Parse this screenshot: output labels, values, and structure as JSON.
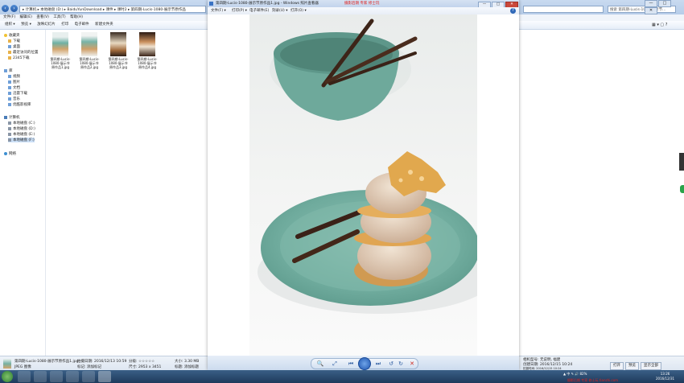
{
  "explorer": {
    "address": "▸ 计算机 ▸ 本地磁盘 (D:) ▸ BaiduYunDownload ▸ 课件 ▸ 课时2 ▸ 第四期-Lucis-1080-展示节原作品",
    "search_placeholder": "搜索 第四期-Lucis-1080-展示节...",
    "window_controls": [
      "—",
      "□",
      "✕"
    ],
    "menu": [
      "文件(F)",
      "编辑(E)",
      "查看(V)",
      "工具(T)",
      "帮助(H)"
    ],
    "toolbar": [
      "组织 ▾",
      "预览 ▾",
      "放映幻灯片",
      "打印",
      "电子邮件",
      "新建文件夹"
    ],
    "view_controls": [
      "▦ ▾",
      "▢",
      "?"
    ],
    "sidebar": {
      "favorites": {
        "label": "收藏夹",
        "items": [
          "下载",
          "桌面",
          "最近访问的位置",
          "2345下载"
        ]
      },
      "libraries": {
        "label": "库",
        "items": [
          "视频",
          "图片",
          "文档",
          "迅雷下载",
          "音乐",
          "优酷影视库"
        ]
      },
      "computer": {
        "label": "计算机",
        "items": [
          "本地磁盘 (C:)",
          "本地磁盘 (D:)",
          "本地磁盘 (E:)",
          "本地磁盘 (F:)"
        ]
      },
      "network": {
        "label": "网络"
      }
    },
    "thumbnails": [
      {
        "label": "第四期-Lucis-1080-展示节原作品1.jpg"
      },
      {
        "label": "第四期-Lucis-1080-展示节原作品2.jpg"
      },
      {
        "label": "第四期-Lucis-1080-展示节原作品3.jpg"
      },
      {
        "label": "第四期-Lucis-1080-展示节原作品4.jpg"
      }
    ],
    "details": {
      "filename": "第四期-Lucis-1080-展示节原作品1.jpg",
      "filetype": "JPEG 图像",
      "date_taken_label": "拍摄日期:",
      "date_taken": "2016/12/13 10:59",
      "tags_label": "标记:",
      "tags": "添加标记",
      "rating_label": "分级:",
      "rating": "☆☆☆☆☆",
      "dimensions_label": "尺寸:",
      "dimensions": "2953 x 3451",
      "size_label": "大小:",
      "size": "3.30 MB",
      "title_label": "标题:",
      "title": "添加标题",
      "author_label": "作者:",
      "author": "添加作者",
      "right_line1": "相机型号: 无说明, 福建",
      "right_line2": "创建日期: 2016/12/15 10:24",
      "right_line3": "拍摄时间: 2016/12/15 10:24"
    },
    "bottom_buttons": [
      "打开",
      "预览",
      "显示全部"
    ]
  },
  "viewer": {
    "title": "第四期-Lucis-1080-展示节原作品1.jpg - Windows 照片查看器",
    "watermark": "摄影后期 专家  修士玩",
    "window_controls": [
      "—",
      "□",
      "✕"
    ],
    "menu": [
      "文件(F) ▾",
      "打印(P) ▾",
      "电子邮件(E)",
      "刻录(U) ▾",
      "打开(O) ▾"
    ],
    "help": "?",
    "controls": {
      "zoom": "🔍▾",
      "fit": "⤢",
      "prev": "⏮",
      "play": "▶",
      "next": "⏭",
      "rotate_ccw": "↺",
      "rotate_cw": "↻",
      "delete": "✕"
    }
  },
  "taskbar": {
    "tray": "▲ 中 ✎ 🔊 82%",
    "time": "13:26",
    "date": "2016/12/31",
    "watermark": "摄影后期 专家 修士玩  tianzhi.com"
  }
}
